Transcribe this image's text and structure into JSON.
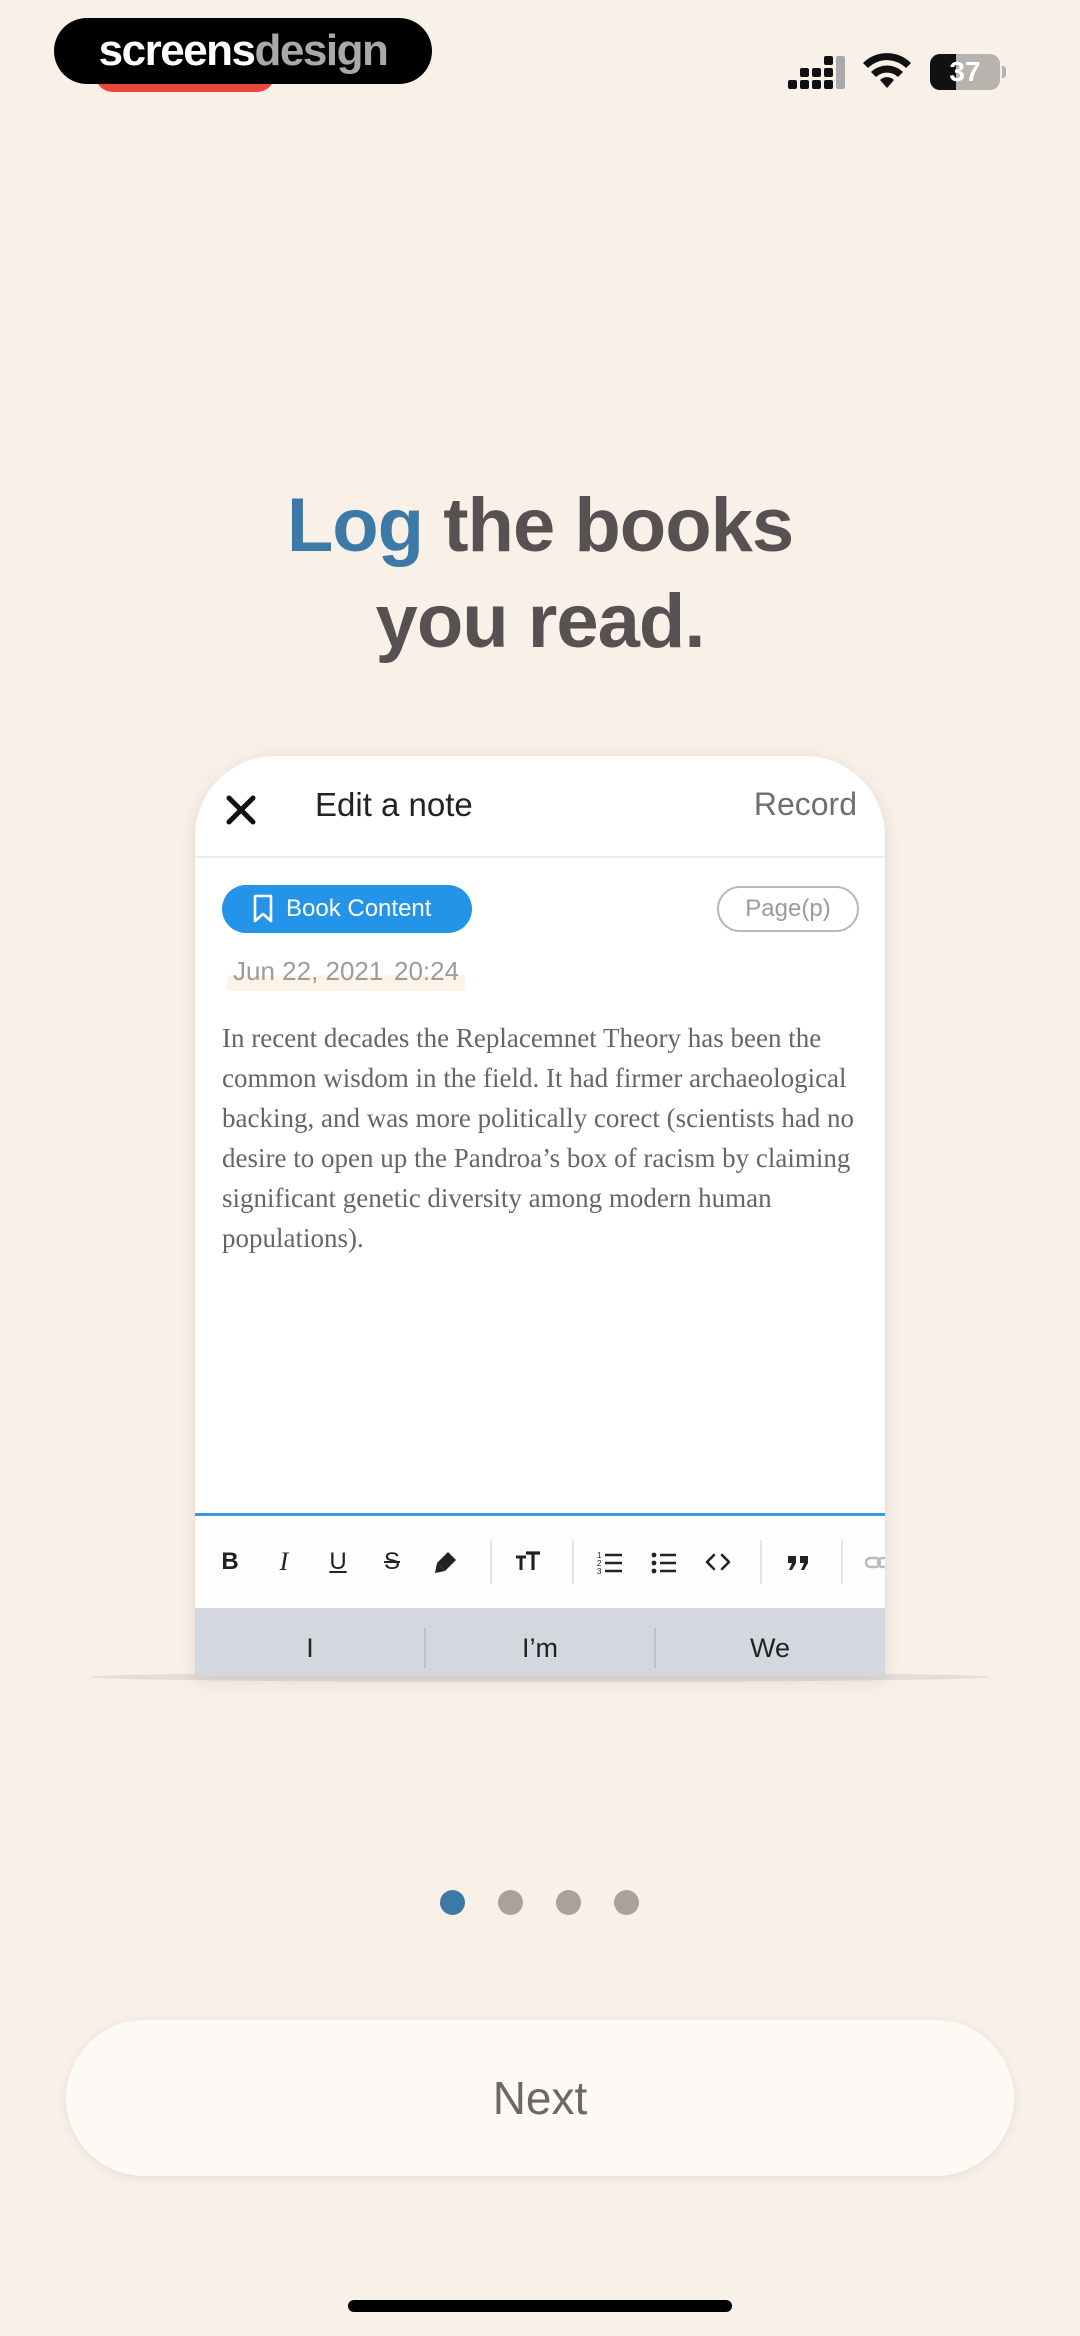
{
  "status_bar": {
    "watermark_part1": "screens",
    "watermark_part2": "design",
    "battery": "37",
    "battery_level": 0.37
  },
  "headline": {
    "accent": "Log",
    "line1_rest": " the books",
    "line2": "you read."
  },
  "note_editor": {
    "title": "Edit a note",
    "record_label": "Record",
    "book_content_label": "Book Content",
    "page_label": "Page(p)",
    "date": "Jun 22, 2021",
    "time": "20:24",
    "body": "In recent decades the Replacemnet Theory has been the common wisdom in the field. It had firmer archaeological backing, and was more politically corect (scientists had no desire to open up the Pandroa’s box of racism by claiming significant genetic diversity among modern human populations).",
    "toolbar": {
      "bold": "B",
      "italic": "I",
      "underline": "U",
      "strikethrough": "S"
    },
    "suggestions": [
      "I",
      "I’m",
      "We"
    ]
  },
  "pagination": {
    "total": 4,
    "active": 1,
    "active_color": "#3d79a6",
    "inactive_color": "#a8a19c"
  },
  "next_label": "Next",
  "colors": {
    "background": "#f9f0e8",
    "accent": "#3d79a6",
    "book_content_button": "#2494e8"
  }
}
